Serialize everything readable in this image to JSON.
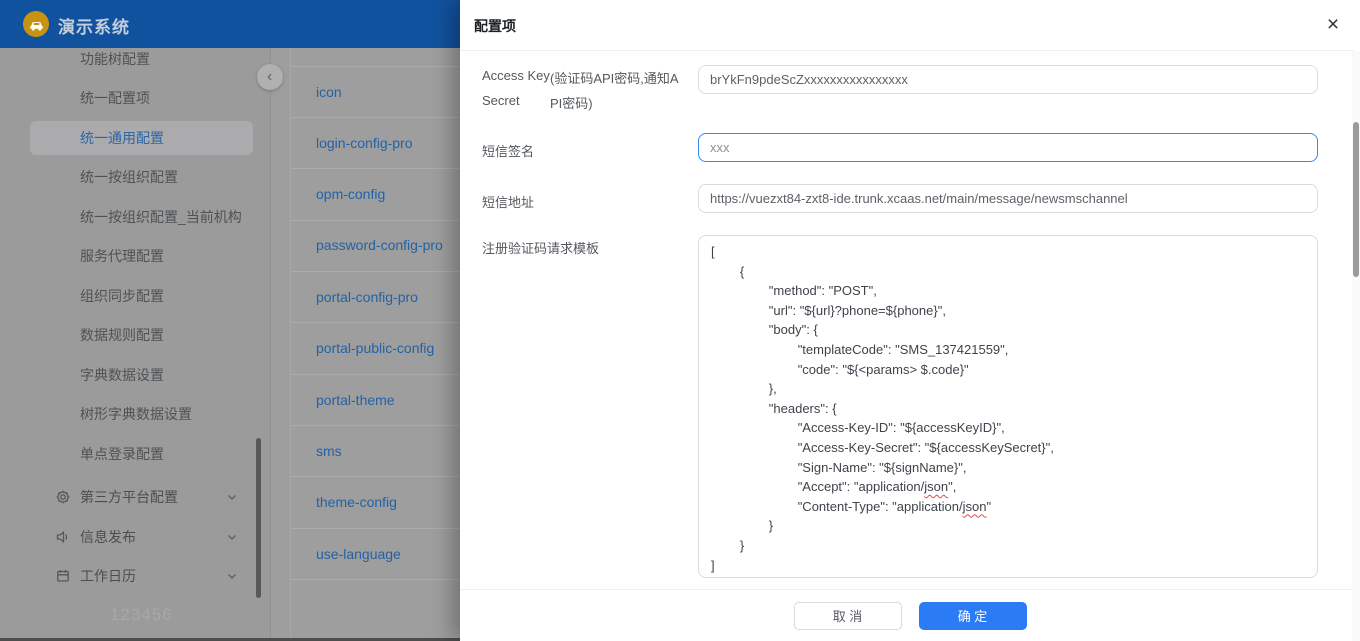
{
  "app": {
    "title": "演示系统"
  },
  "sidebar": {
    "items": [
      "功能树配置",
      "统一配置项",
      "统一通用配置",
      "统一按组织配置",
      "统一按组织配置_当前机构",
      "服务代理配置",
      "组织同步配置",
      "数据规则配置",
      "字典数据设置",
      "树形字典数据设置",
      "单点登录配置"
    ],
    "selected": "统一通用配置",
    "groups": [
      {
        "icon": "gear-icon",
        "label": "第三方平台配置"
      },
      {
        "icon": "speaker-icon",
        "label": "信息发布"
      },
      {
        "icon": "calendar-icon",
        "label": "工作日历"
      }
    ],
    "watermark": "123456"
  },
  "config_list": {
    "items": [
      "icon",
      "login-config-pro",
      "opm-config",
      "password-config-pro",
      "portal-config-pro",
      "portal-public-config",
      "portal-theme",
      "sms",
      "theme-config",
      "use-language"
    ]
  },
  "drawer": {
    "title": "配置项",
    "fields": {
      "access_key_secret": {
        "label_line1": "Access Key",
        "label_line2": "Secret",
        "hint_line1": "(验证码API密码,通知A",
        "hint_line2": "PI密码)",
        "value": "brYkFn9pdeScZxxxxxxxxxxxxxxxx"
      },
      "sms_sign": {
        "label": "短信签名",
        "value": "xxx"
      },
      "sms_url": {
        "label": "短信地址",
        "value": "https://vuezxt84-zxt8-ide.trunk.xcaas.net/main/message/newsmschannel"
      },
      "register_template": {
        "label": "注册验证码请求模板",
        "value": "[\n\t{\n\t\t\"method\": \"POST\",\n\t\t\"url\": \"${url}?phone=${phone}\",\n\t\t\"body\": {\n\t\t\t\"templateCode\": \"SMS_137421559\",\n\t\t\t\"code\": \"${<params> $.code}\"\n\t\t},\n\t\t\"headers\": {\n\t\t\t\"Access-Key-ID\": \"${accessKeyID}\",\n\t\t\t\"Access-Key-Secret\": \"${accessKeySecret}\",\n\t\t\t\"Sign-Name\": \"${signName}\",\n\t\t\t\"Accept\": \"application/json\",\n\t\t\t\"Content-Type\": \"application/json\"\n\t\t}\n\t}\n]"
      }
    },
    "footer": {
      "cancel": "取 消",
      "confirm": "确 定"
    }
  },
  "colors": {
    "topbar": "#11529e",
    "accent": "#2b7bf4",
    "link": "#2362a6",
    "focus": "#3b86f7",
    "squiggle": "#e5484d"
  }
}
